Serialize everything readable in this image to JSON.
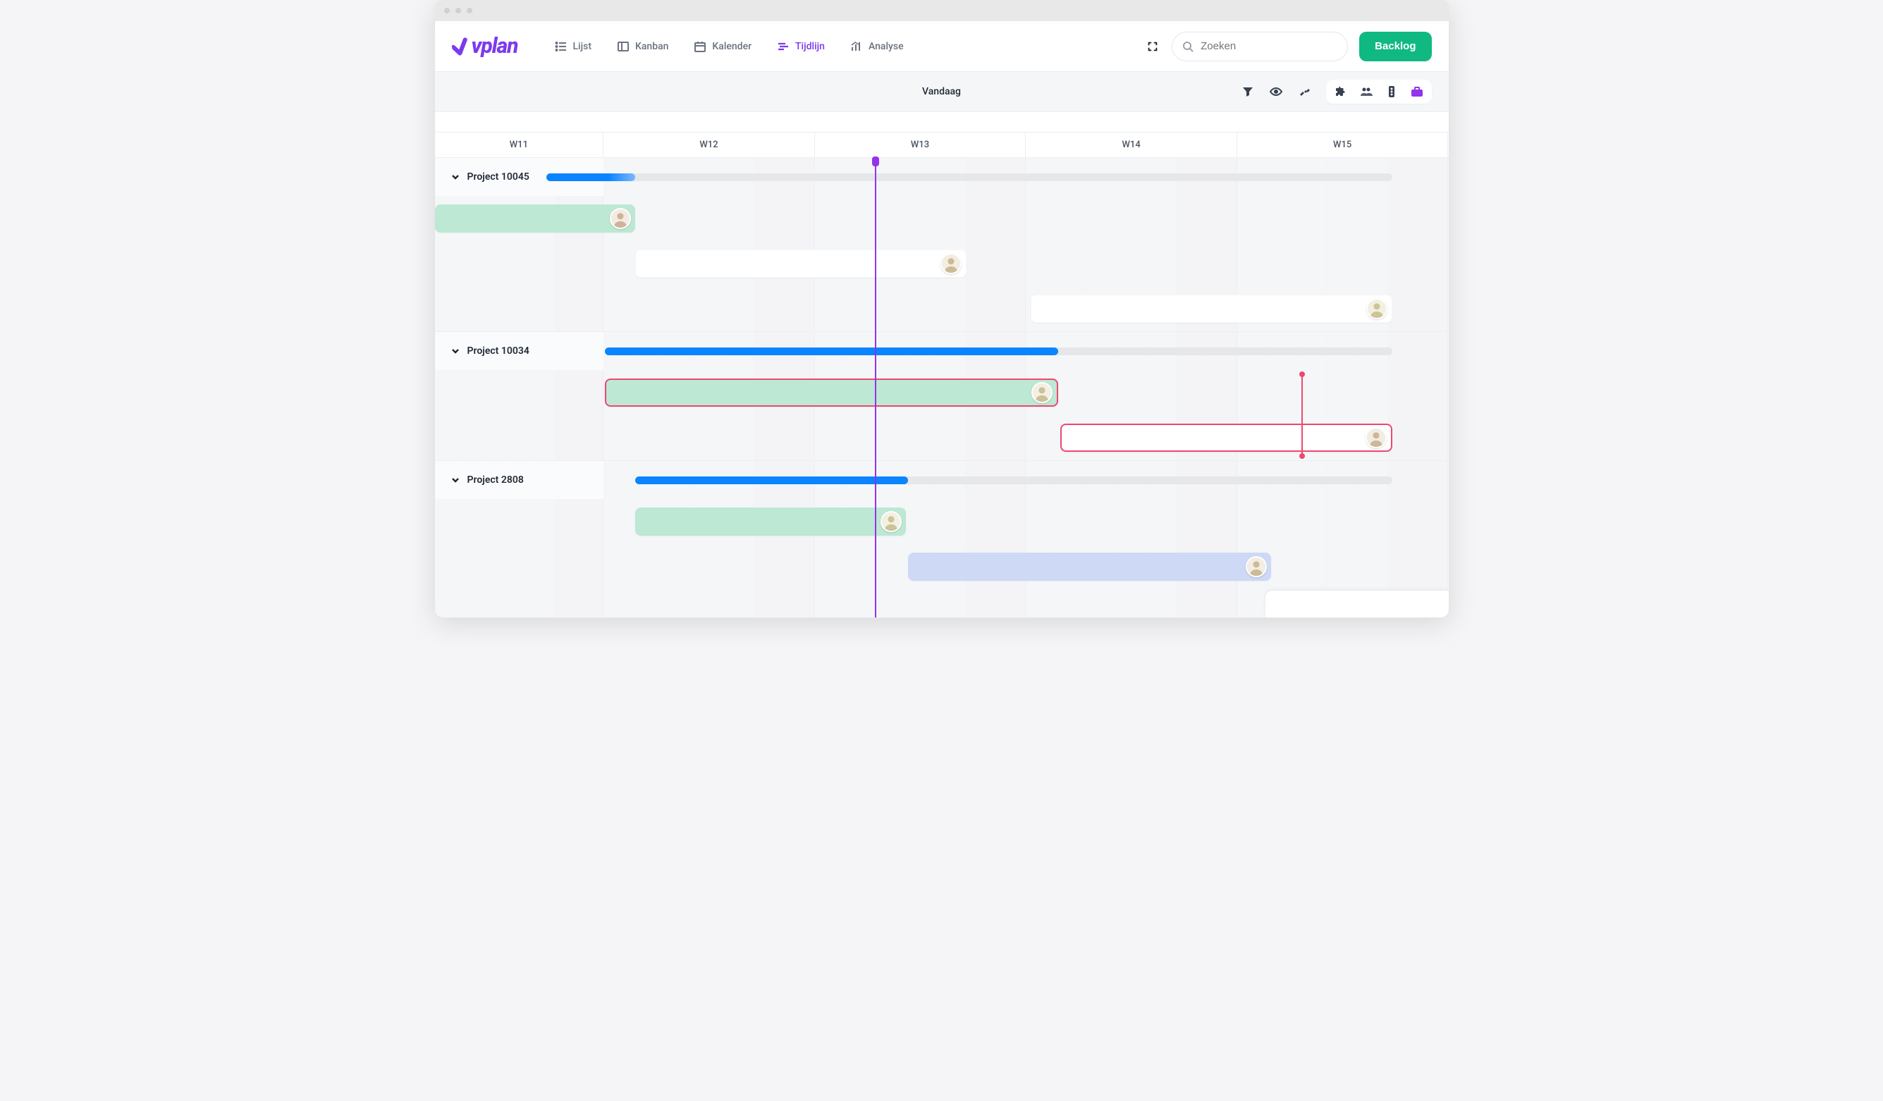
{
  "brand": "vplan",
  "nav": {
    "lijst": "Lijst",
    "kanban": "Kanban",
    "kalender": "Kalender",
    "tijdlijn": "Tijdlijn",
    "analyse": "Analyse"
  },
  "search": {
    "placeholder": "Zoeken"
  },
  "backlog_label": "Backlog",
  "today_label": "Vandaag",
  "weeks": [
    "W11",
    "W12",
    "W13",
    "W14",
    "W15"
  ],
  "today_week": "W13",
  "projects": [
    {
      "name": "Project 10045",
      "progress_start_pct": 11.0,
      "progress_end_pct": 94.5,
      "progress_fill_end_pct": 19.8,
      "gradient": true,
      "tasks": [
        {
          "start_pct": 0,
          "end_pct": 19.8,
          "style": "green",
          "assignee": "person-1"
        },
        {
          "start_pct": 19.8,
          "end_pct": 52.5,
          "style": "white",
          "assignee": "person-2"
        },
        {
          "start_pct": 58.8,
          "end_pct": 94.5,
          "style": "white",
          "assignee": "person-3"
        }
      ]
    },
    {
      "name": "Project 10034",
      "progress_start_pct": 16.8,
      "progress_end_pct": 94.5,
      "progress_fill_end_pct": 61.5,
      "deadline_pct": 85.5,
      "tasks": [
        {
          "start_pct": 16.8,
          "end_pct": 61.5,
          "style": "red-outline",
          "assignee": "person-4"
        },
        {
          "start_pct": 61.7,
          "end_pct": 94.5,
          "style": "red-outline white-bg",
          "assignee": "person-5"
        }
      ]
    },
    {
      "name": "Project 2808",
      "progress_start_pct": 19.8,
      "progress_end_pct": 94.5,
      "progress_fill_end_pct": 46.7,
      "tasks": [
        {
          "start_pct": 19.8,
          "end_pct": 46.5,
          "style": "green",
          "assignee": "person-6"
        },
        {
          "start_pct": 46.7,
          "end_pct": 82.5,
          "style": "blue-light",
          "assignee": "person-7"
        }
      ]
    }
  ]
}
